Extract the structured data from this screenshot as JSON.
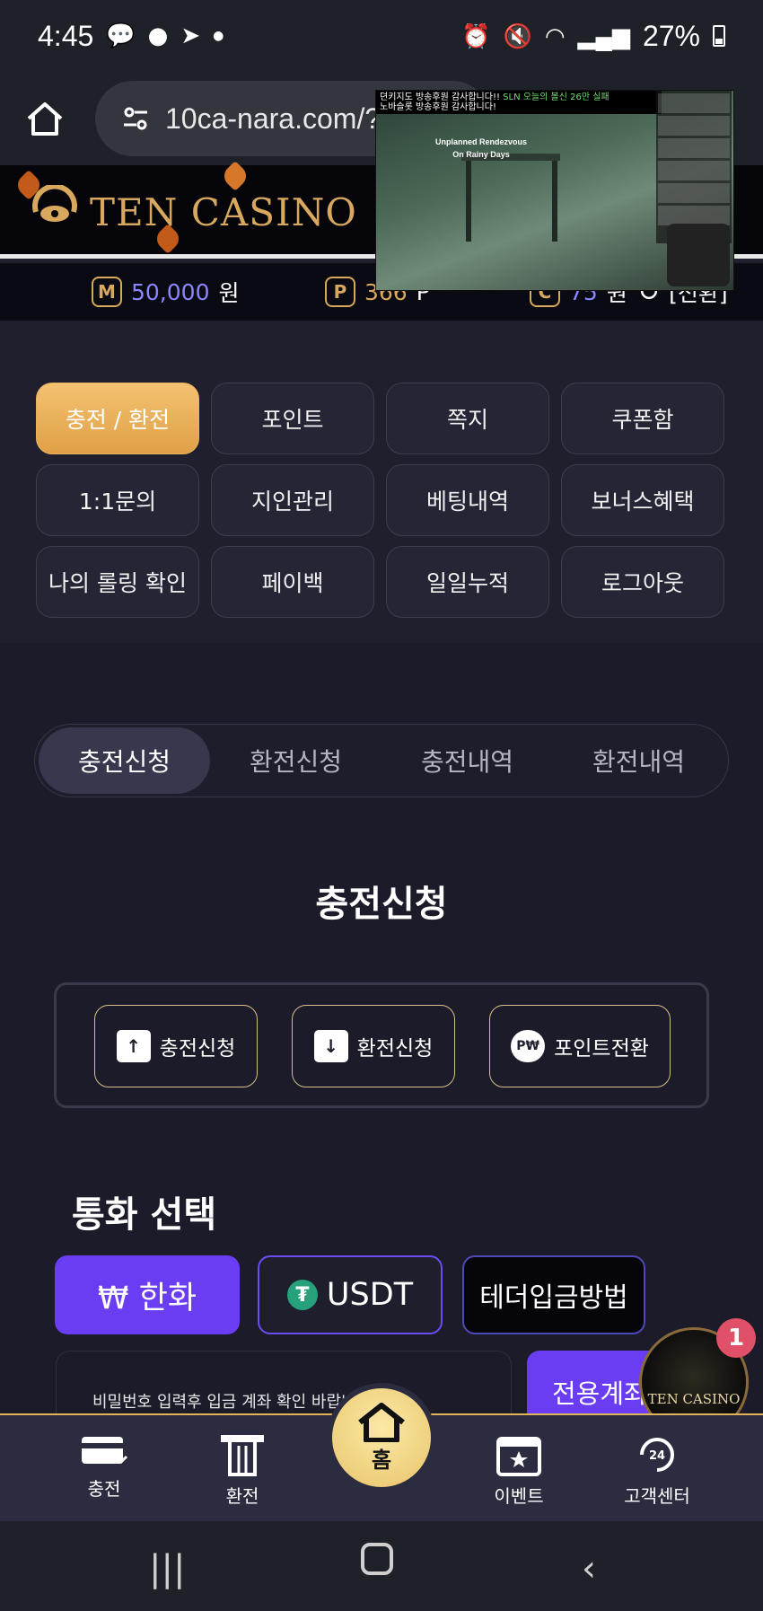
{
  "status_bar": {
    "time": "4:45",
    "battery": "27%",
    "icons": [
      "talk-icon",
      "messenger-icon",
      "telegram-icon",
      "dot",
      "alarm-icon",
      "mute-icon",
      "wifi-icon",
      "signal-icon",
      "battery-icon"
    ]
  },
  "browser": {
    "url": "10ca-nara.com/?"
  },
  "header": {
    "logo_text": "TEN CASINO"
  },
  "balance": {
    "money_badge": "M",
    "money_value": "50,000",
    "money_unit": "원",
    "point_badge": "P",
    "point_value": "366",
    "point_unit": "P",
    "coupon_badge": "C",
    "coupon_value": "75",
    "coupon_unit": "원",
    "refresh_label": "[전환]"
  },
  "video_overlay": {
    "banner_line1": "뎐키지도 방송후원 감사합니다!! ",
    "banner_highlight": "SLN 오늘의 볼신 26만 실패",
    "banner_line2": "노바슬롯 방송후원 감사합니다!",
    "caption_line1": "Unplanned Rendezvous",
    "caption_line2": "On Rainy Days"
  },
  "menu": {
    "items": [
      "충전 / 환전",
      "포인트",
      "쪽지",
      "쿠폰함",
      "1:1문의",
      "지인관리",
      "베팅내역",
      "보너스혜택",
      "나의 롤링 확인",
      "페이백",
      "일일누적",
      "로그아웃"
    ]
  },
  "tabs": [
    "충전신청",
    "환전신청",
    "충전내역",
    "환전내역"
  ],
  "page_heading": "충전신청",
  "actions": {
    "deposit": "충전신청",
    "withdraw": "환전신청",
    "point_convert": "포인트전환"
  },
  "currency": {
    "title": "통화 선택",
    "krw": "₩ 한화",
    "usdt": "USDT",
    "method": "테더입금방법"
  },
  "notice": {
    "text": "비밀번호 입력후 입금 계좌 확인 바랍니",
    "dedicated_account": "전용계좌"
  },
  "floating": {
    "logo_text": "TEN CASINO",
    "badge_count": "1"
  },
  "bottom_nav": {
    "deposit": "충전",
    "withdraw": "환전",
    "home": "홈",
    "event": "이벤트",
    "support": "고객센터"
  },
  "colors": {
    "accent_gold": "#e0a047",
    "accent_purple": "#6a3cf2",
    "background": "#1f1f2e"
  }
}
